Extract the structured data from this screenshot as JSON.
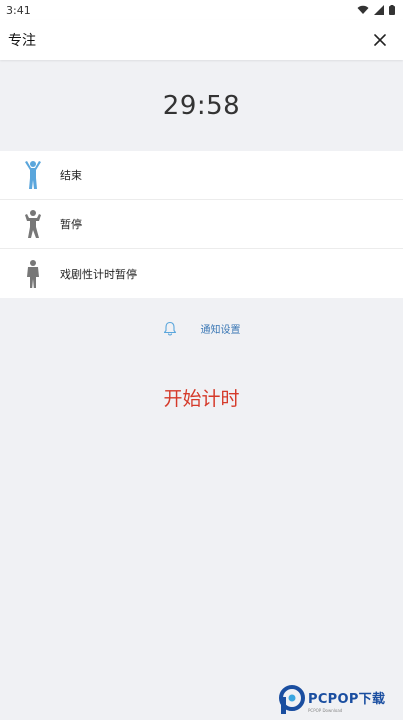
{
  "status_bar": {
    "time": "3:41"
  },
  "app_bar": {
    "title": "专注"
  },
  "timer": {
    "value": "29:58"
  },
  "options": [
    {
      "label": "结束",
      "icon": "person-arms-up-icon",
      "color": "#5aa6dc"
    },
    {
      "label": "暂停",
      "icon": "person-flexing-icon",
      "color": "#777777"
    },
    {
      "label": "戏剧性计时暂停",
      "icon": "person-standing-icon",
      "color": "#777777"
    }
  ],
  "notification": {
    "label": "通知设置",
    "icon": "bell-icon"
  },
  "start": {
    "label": "开始计时",
    "color": "#d53a2a"
  },
  "watermark": {
    "logo": "PCPOP下载",
    "sub": "PCPOP Download"
  }
}
